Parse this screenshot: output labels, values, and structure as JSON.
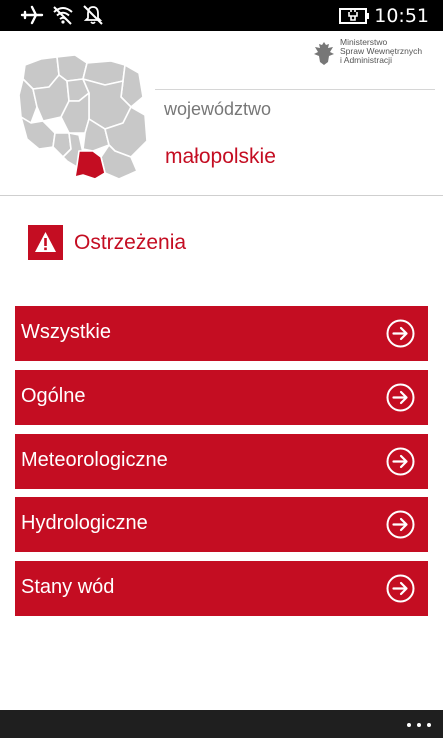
{
  "status_bar": {
    "time": "10:51",
    "icons": [
      "airplane-icon",
      "wifi-icon",
      "quiet-hours-icon",
      "battery-charging-icon"
    ]
  },
  "header": {
    "ministry_lines": [
      "Ministerstwo",
      "Spraw Wewnętrznych",
      "i Administracji"
    ],
    "region_label": "województwo",
    "region_value": "małopolskie"
  },
  "section": {
    "title": "Ostrzeżenia",
    "icon": "warning-icon"
  },
  "menu": {
    "items": [
      {
        "label": "Wszystkie"
      },
      {
        "label": "Ogólne"
      },
      {
        "label": "Meteorologiczne"
      },
      {
        "label": "Hydrologiczne"
      },
      {
        "label": "Stany wód"
      }
    ]
  },
  "colors": {
    "accent": "#c40d22",
    "map_fill": "#c8c8c8",
    "status_bar": "#000000",
    "app_bar": "#1f1f1f"
  }
}
